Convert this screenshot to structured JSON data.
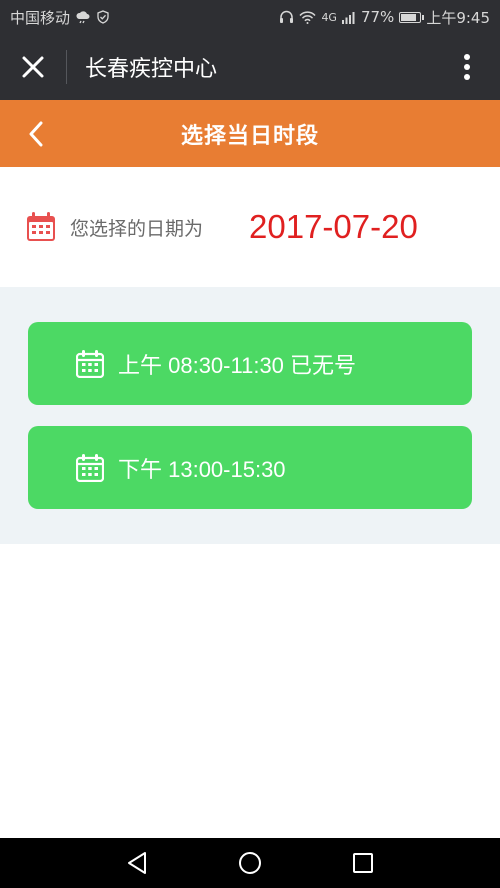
{
  "status_bar": {
    "carrier": "中国移动",
    "network": "4G",
    "battery": "77%",
    "time": "上午9:45"
  },
  "app_bar": {
    "title": "长春疾控中心",
    "icons": [
      "close-icon",
      "more-vertical-icon"
    ]
  },
  "header": {
    "title": "选择当日时段",
    "back_icon": "chevron-left-icon"
  },
  "date_section": {
    "label": "您选择的日期为",
    "value": "2017-07-20",
    "icon": "calendar-icon",
    "icon_color": "#e8504f",
    "value_color": "#e02020"
  },
  "slots": [
    {
      "label": "上午 08:30-11:30 已无号",
      "icon": "calendar-icon"
    },
    {
      "label": "下午 13:00-15:30",
      "icon": "calendar-icon"
    }
  ],
  "colors": {
    "header_bg": "#e87d33",
    "app_bar_bg": "#2e2f33",
    "slot_bg": "#4cd964",
    "slots_area_bg": "#eef3f6"
  },
  "nav_bar": {
    "icons": [
      "back-triangle-icon",
      "home-circle-icon",
      "recents-square-icon"
    ]
  }
}
